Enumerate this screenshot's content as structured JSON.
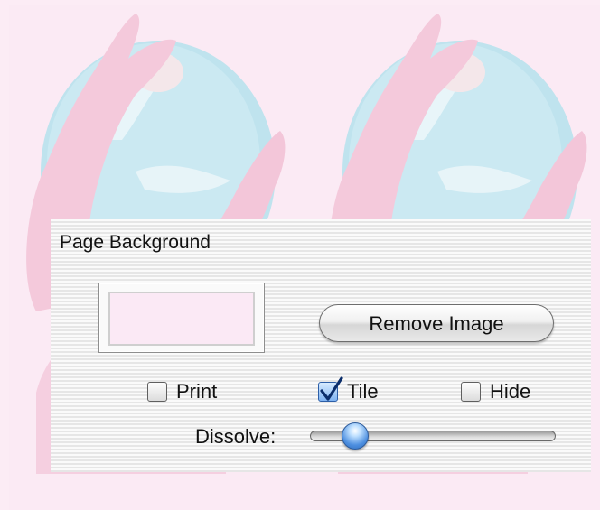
{
  "panel": {
    "title": "Page Background",
    "remove_image_label": "Remove Image",
    "swatch_color": "#fbe9f5",
    "options": {
      "print": {
        "label": "Print",
        "checked": false
      },
      "tile": {
        "label": "Tile",
        "checked": true
      },
      "hide": {
        "label": "Hide",
        "checked": false
      }
    },
    "dissolve": {
      "label": "Dissolve:",
      "value_fraction": 0.15
    }
  },
  "background": {
    "tile_color": "#fbeaf4"
  }
}
